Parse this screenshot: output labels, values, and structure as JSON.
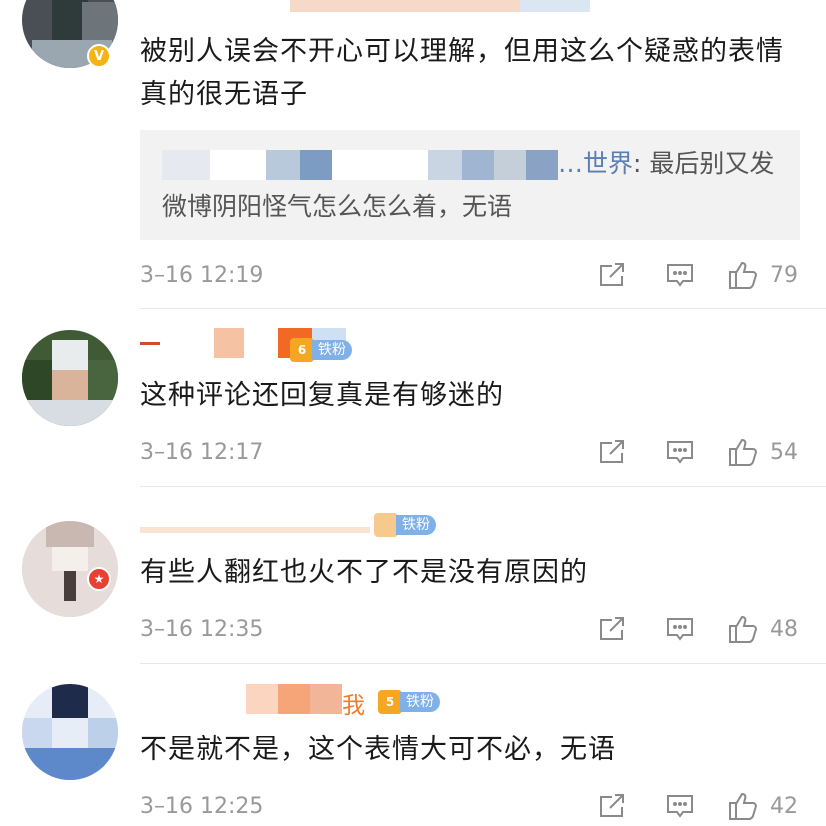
{
  "comments": [
    {
      "text": "被别人误会不开心可以理解，但用这么个疑惑的表情真的很无语子",
      "verified_badge": "V",
      "reply": {
        "author": "…世界",
        "text": ": 最后别又发微博阴阳怪气怎么怎么着，无语"
      },
      "time": "3–16 12:19",
      "likes": "79"
    },
    {
      "text": "这种评论还回复真是有够迷的",
      "fan_badge": {
        "level": "6",
        "label": "铁粉"
      },
      "time": "3–16 12:17",
      "likes": "54"
    },
    {
      "text": "有些人翻红也火不了不是没有原因的",
      "fan_badge": {
        "level": "",
        "label": "铁粉"
      },
      "time": "3–16 12:35",
      "likes": "48"
    },
    {
      "name_tail": "我",
      "text": "不是就不是，这个表情大可不必，无语",
      "fan_badge": {
        "level": "5",
        "label": "铁粉"
      },
      "time": "3–16 12:25",
      "likes": "42"
    }
  ],
  "icons": {
    "repost": "repost-icon",
    "reply": "comment-icon",
    "like": "thumbs-up-icon",
    "verified": "verified-v-icon",
    "fan_crown": "fan-crown-icon"
  },
  "colors": {
    "verified": "#f4b414",
    "star_badge": "#e8412f",
    "fan_badge": "#7fb0e8",
    "crown": "#f5a623",
    "meta_gray": "#999999",
    "reply_bg": "#f2f2f2"
  }
}
